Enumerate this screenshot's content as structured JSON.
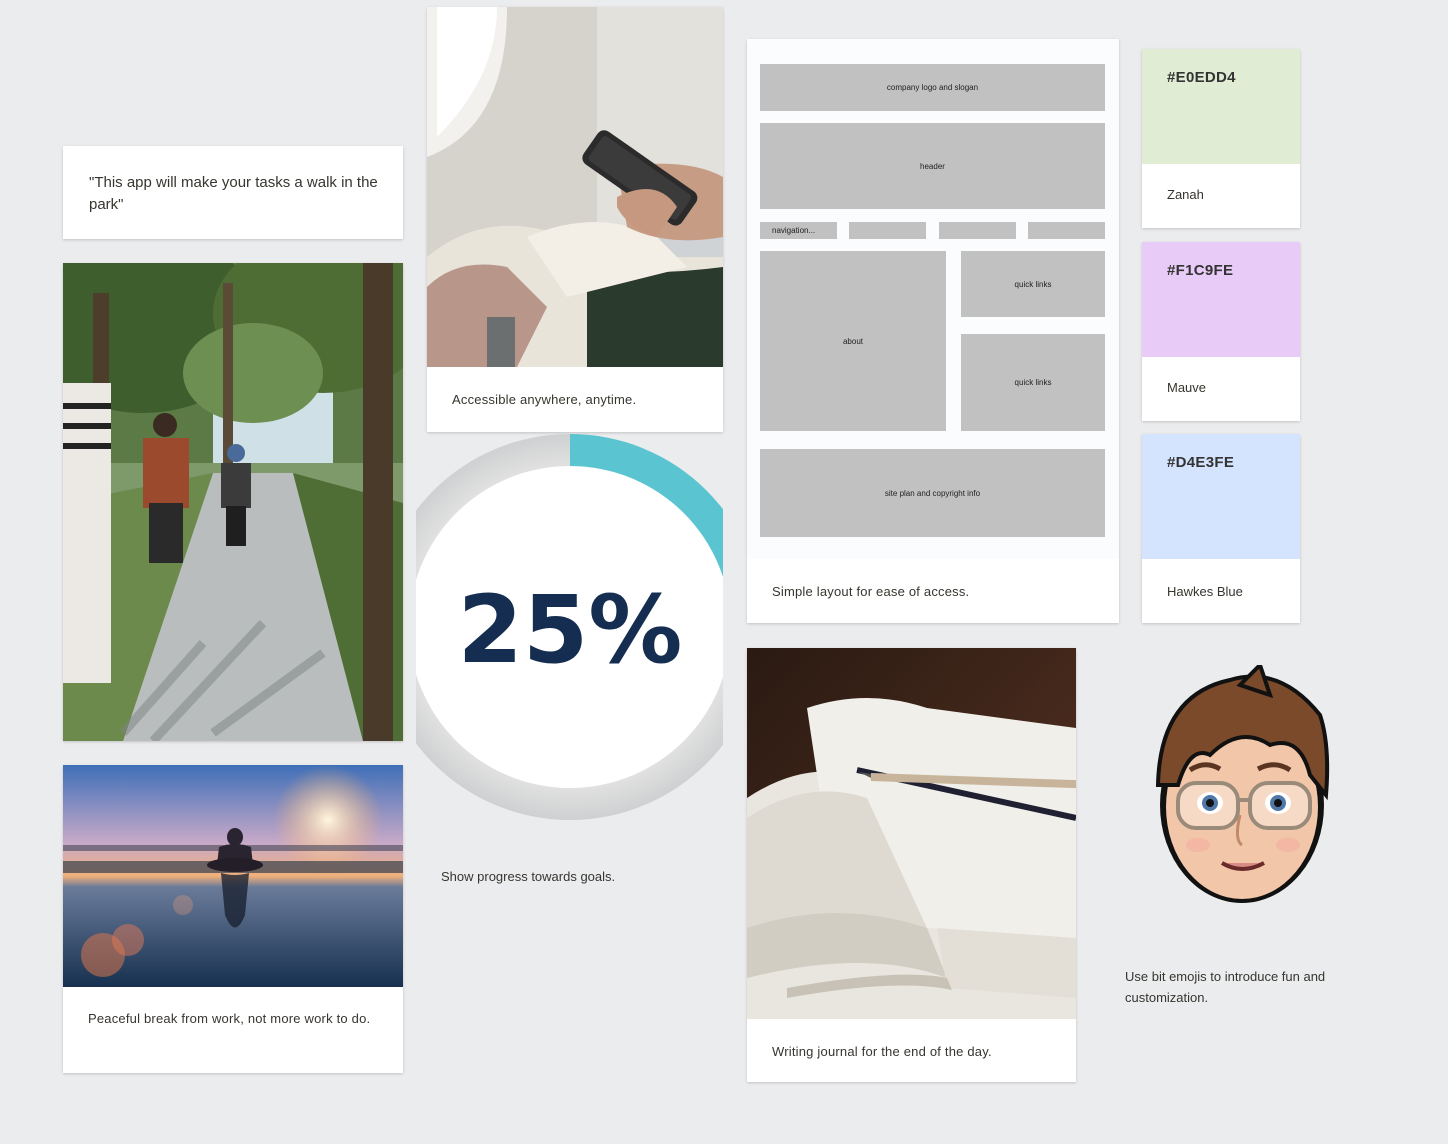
{
  "quote": {
    "text": "\"This app will make your tasks a walk in the park\""
  },
  "cards": {
    "walk_photo": {
      "icon": "park-walk-photo"
    },
    "meditation": {
      "icon": "meditation-sunset-photo",
      "caption": "Peaceful break from work, not more work to do."
    },
    "phone": {
      "icon": "phone-in-hands-photo",
      "caption": "Accessible anywhere, anytime."
    },
    "progress": {
      "value_text": "25%",
      "percent": 25,
      "accent": "#5bc4d1",
      "text_color": "#152d50",
      "caption": "Show progress towards goals."
    },
    "layout": {
      "caption": "Simple layout for ease of access.",
      "boxes": {
        "logo": "company logo and slogan",
        "header": "header",
        "nav": "navigation...",
        "about": "about",
        "quick1": "quick links",
        "quick2": "quick links",
        "footer": "site plan and copyright info"
      }
    },
    "journal": {
      "icon": "open-journal-pencil-photo",
      "caption": "Writing journal for the end of the day."
    },
    "avatar": {
      "icon": "bitmoji-avatar",
      "caption": "Use bit emojis to introduce fun and customization."
    }
  },
  "swatches": [
    {
      "hex": "#E0EDD4",
      "name": "Zanah",
      "color": "#e0edd4"
    },
    {
      "hex": "#F1C9FE",
      "name": "Mauve",
      "color": "#e8cbf6"
    },
    {
      "hex": "#D4E3FE",
      "name": "Hawkes Blue",
      "color": "#d4e3fe"
    }
  ]
}
